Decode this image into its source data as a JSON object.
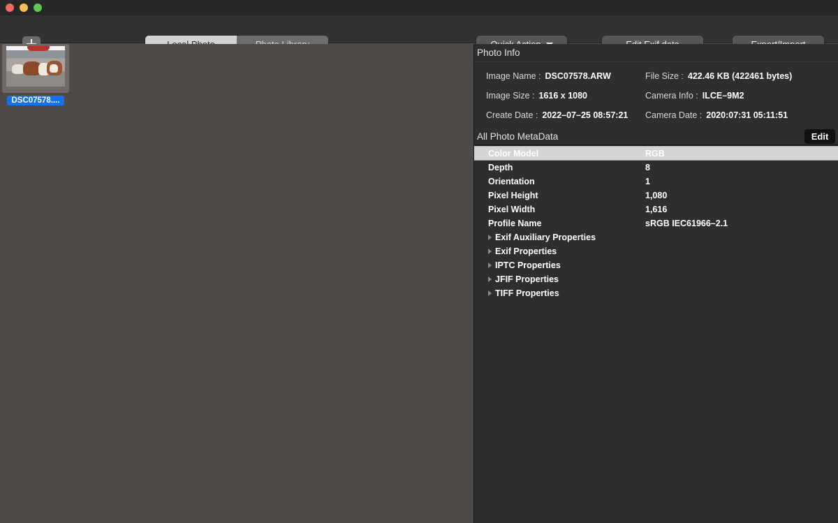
{
  "window": {
    "traffic_lights": [
      {
        "name": "close",
        "color": "#ec6a5f"
      },
      {
        "name": "minimize",
        "color": "#f5bf4f"
      },
      {
        "name": "zoom",
        "color": "#61c554"
      }
    ]
  },
  "toolbar": {
    "add_button_label": "+",
    "add_dropdown_label": "",
    "segments": [
      {
        "label": "Local Photo",
        "selected": true
      },
      {
        "label": "Photo Library",
        "selected": false
      }
    ],
    "quick_action_label": "Quick Action",
    "edit_exif_label": "Edit Exif data",
    "export_import_label": "Export/Import"
  },
  "sidebar": {
    "items": [
      {
        "label": "DSC07578....",
        "selected": true
      }
    ]
  },
  "panel": {
    "photo_info": {
      "title": "Photo Info",
      "rows": [
        [
          {
            "label": "Image Name :",
            "value": "DSC07578.ARW"
          },
          {
            "label": "File Size :",
            "value": "422.46 KB (422461 bytes)"
          }
        ],
        [
          {
            "label": "Image Size :",
            "value": "1616 x 1080"
          },
          {
            "label": "Camera Info :",
            "value": "ILCE–9M2"
          }
        ],
        [
          {
            "label": "Create Date :",
            "value": "2022–07–25 08:57:21"
          },
          {
            "label": "Camera Date :",
            "value": "2020:07:31 05:11:51"
          }
        ]
      ]
    },
    "metadata": {
      "title": "All Photo MetaData",
      "edit_label": "Edit",
      "rows": [
        {
          "key": "Color Model",
          "value": "RGB",
          "selected": true,
          "expandable": false
        },
        {
          "key": "Depth",
          "value": "8",
          "selected": false,
          "expandable": false
        },
        {
          "key": "Orientation",
          "value": "1",
          "selected": false,
          "expandable": false
        },
        {
          "key": "Pixel Height",
          "value": "1,080",
          "selected": false,
          "expandable": false
        },
        {
          "key": "Pixel Width",
          "value": "1,616",
          "selected": false,
          "expandable": false
        },
        {
          "key": "Profile Name",
          "value": "sRGB IEC61966–2.1",
          "selected": false,
          "expandable": false
        },
        {
          "key": "Exif Auxiliary Properties",
          "value": "",
          "selected": false,
          "expandable": true
        },
        {
          "key": "Exif Properties",
          "value": "",
          "selected": false,
          "expandable": true
        },
        {
          "key": "IPTC Properties",
          "value": "",
          "selected": false,
          "expandable": true
        },
        {
          "key": "JFIF Properties",
          "value": "",
          "selected": false,
          "expandable": true
        },
        {
          "key": "TIFF Properties",
          "value": "",
          "selected": false,
          "expandable": true
        }
      ]
    }
  },
  "colors": {
    "titlebar": "#272727",
    "toolbar": "#333232",
    "canvas": "#4e4a47",
    "panel": "#2e2e2e",
    "selection_blue": "#1272f0",
    "row_selected": "#d4d4d4"
  }
}
